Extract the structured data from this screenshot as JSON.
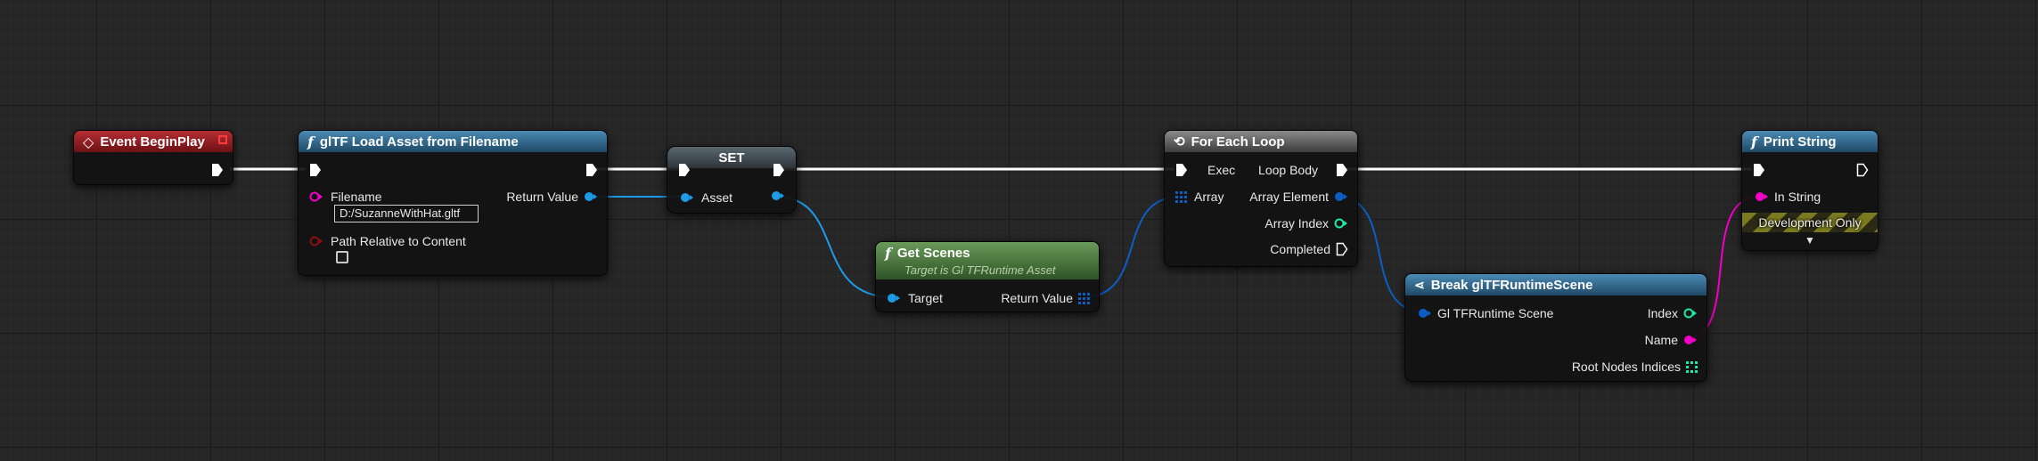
{
  "colors": {
    "exec": "#ffffff",
    "object": "#1e9be6",
    "string": "#f200c8",
    "integer": "#1ee8a8",
    "structure": "#0c5ec4",
    "event_header": "#a32229",
    "function_header": "#3a6f95",
    "pure_header": "#4e7c41",
    "macro_header": "#6b6b6b"
  },
  "nodes": {
    "event_begin_play": {
      "title": "Event BeginPlay"
    },
    "gltf_load": {
      "title": "glTF Load Asset from Filename",
      "filename_label": "Filename",
      "filename_value": "D:/SuzanneWithHat.gltf",
      "return_label": "Return Value",
      "path_relative_label": "Path Relative to Content",
      "path_relative_checked": false
    },
    "set": {
      "title": "SET",
      "asset_label": "Asset"
    },
    "get_scenes": {
      "title": "Get Scenes",
      "subtitle": "Target is Gl TFRuntime Asset",
      "target_label": "Target",
      "return_label": "Return Value"
    },
    "for_each": {
      "title": "For Each Loop",
      "exec_label": "Exec",
      "array_label": "Array",
      "loop_body_label": "Loop Body",
      "array_element_label": "Array Element",
      "array_index_label": "Array Index",
      "completed_label": "Completed"
    },
    "break_scene": {
      "title": "Break glTFRuntimeScene",
      "input_label": "Gl TFRuntime Scene",
      "index_label": "Index",
      "name_label": "Name",
      "root_label": "Root Nodes Indices"
    },
    "print_string": {
      "title": "Print String",
      "in_string_label": "In String",
      "dev_only_label": "Development Only"
    }
  }
}
